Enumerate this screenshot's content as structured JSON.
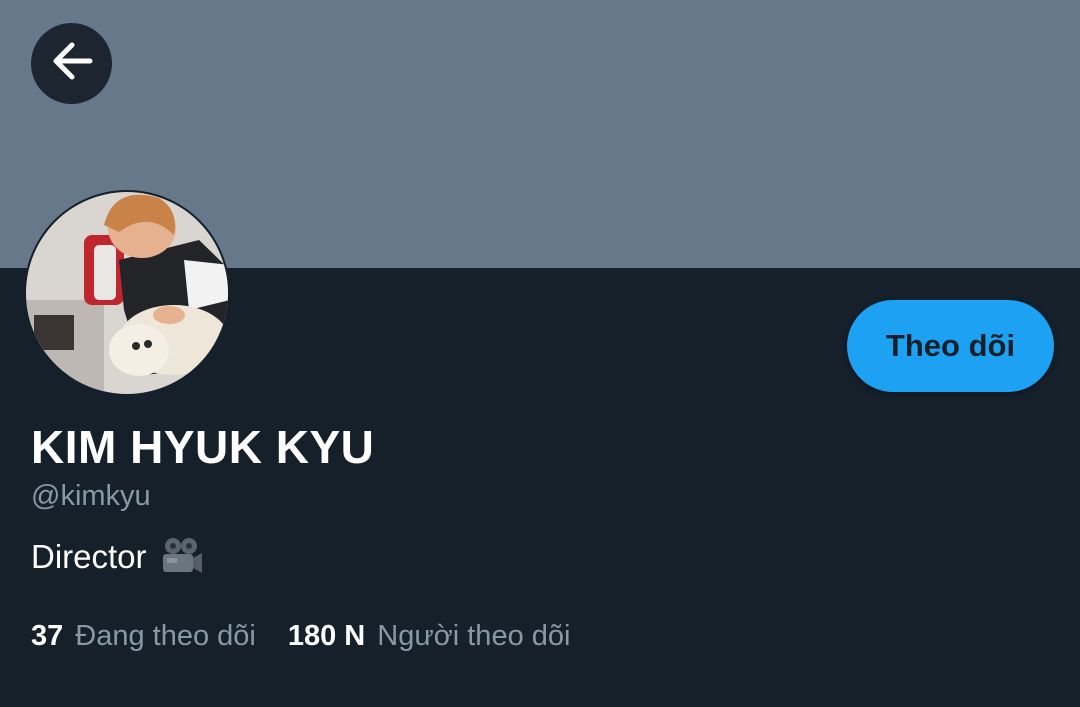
{
  "header": {
    "back_icon": "arrow-left-icon",
    "banner_color": "#66788a"
  },
  "profile": {
    "avatar_icon": "profile-photo",
    "follow_label": "Theo dõi",
    "name": "KIM HYUK KYU",
    "handle": "@kimkyu",
    "bio": "Director",
    "bio_icon": "movie-camera-icon"
  },
  "stats": {
    "following_count": "37",
    "following_label": "Đang theo dõi",
    "followers_count": "180 N",
    "followers_label": "Người theo dõi"
  },
  "colors": {
    "background": "#15202b",
    "accent": "#1da1f2",
    "secondary_text": "#8899a6"
  }
}
